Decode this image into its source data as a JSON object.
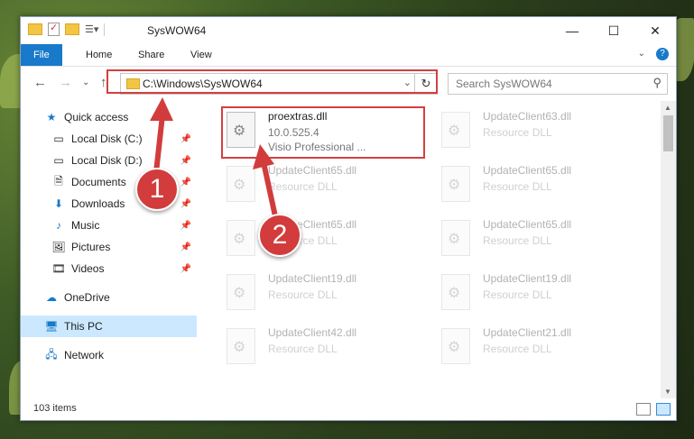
{
  "window": {
    "title": "SysWOW64",
    "controls": {
      "minimize": "—",
      "maximize": "☐",
      "close": "✕"
    }
  },
  "ribbon": {
    "tabs": [
      "File",
      "Home",
      "Share",
      "View"
    ],
    "help": "?"
  },
  "nav": {
    "address": "C:\\Windows\\SysWOW64",
    "search_placeholder": "Search SysWOW64"
  },
  "sidebar": {
    "items": [
      {
        "label": "Quick access"
      },
      {
        "label": "Local Disk (C:)"
      },
      {
        "label": "Local Disk (D:)"
      },
      {
        "label": "Documents"
      },
      {
        "label": "Downloads"
      },
      {
        "label": "Music"
      },
      {
        "label": "Pictures"
      },
      {
        "label": "Videos"
      },
      {
        "label": "OneDrive"
      },
      {
        "label": "This PC"
      },
      {
        "label": "Network"
      }
    ]
  },
  "files": {
    "highlighted": {
      "name": "proextras.dll",
      "version": "10.0.525.4",
      "description": "Visio Professional ..."
    },
    "others": [
      {
        "name": "UpdateClient63.dll",
        "description": "Resource DLL"
      },
      {
        "name": "UpdateClient65.dll",
        "description": "Resource DLL"
      },
      {
        "name": "UpdateClient65.dll",
        "description": "Resource DLL"
      },
      {
        "name": "UpdateClient65.dll",
        "description": "Resource DLL"
      },
      {
        "name": "UpdateClient65.dll",
        "description": "Resource DLL"
      },
      {
        "name": "UpdateClient19.dll",
        "description": "Resource DLL"
      },
      {
        "name": "UpdateClient19.dll",
        "description": "Resource DLL"
      },
      {
        "name": "UpdateClient42.dll",
        "description": "Resource DLL"
      },
      {
        "name": "UpdateClient21.dll",
        "description": "Resource DLL"
      }
    ]
  },
  "status": {
    "items": "103 items"
  },
  "callouts": [
    "1",
    "2"
  ],
  "colors": {
    "accent": "#1979ca",
    "highlight_box": "#d43f3f",
    "selected": "#cce8ff"
  }
}
